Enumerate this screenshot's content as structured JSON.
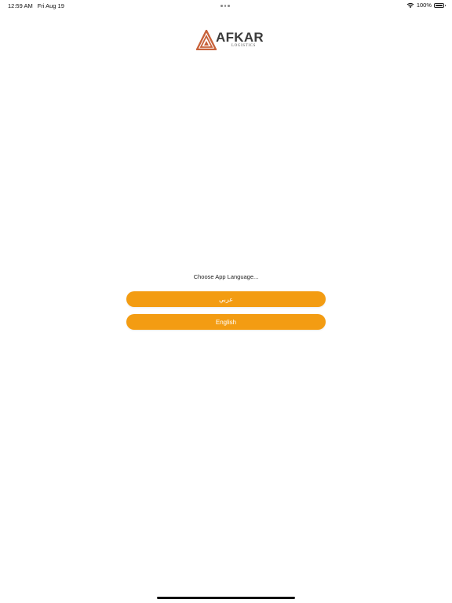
{
  "status_bar": {
    "time": "12:59 AM",
    "date": "Fri Aug 19",
    "battery": "100%",
    "icons": {
      "wifi": "wifi-icon",
      "battery": "battery-icon",
      "multitask": "multitask-dots-icon"
    }
  },
  "logo": {
    "word": "AFKAR",
    "subtitle": "LOGISTICS",
    "mark_icon": "afkar-triangle-logo",
    "mark_color": "#c8623a"
  },
  "language": {
    "prompt": "Choose App Language...",
    "arabic_label": "عربي",
    "english_label": "English",
    "button_color": "#f39c12"
  }
}
